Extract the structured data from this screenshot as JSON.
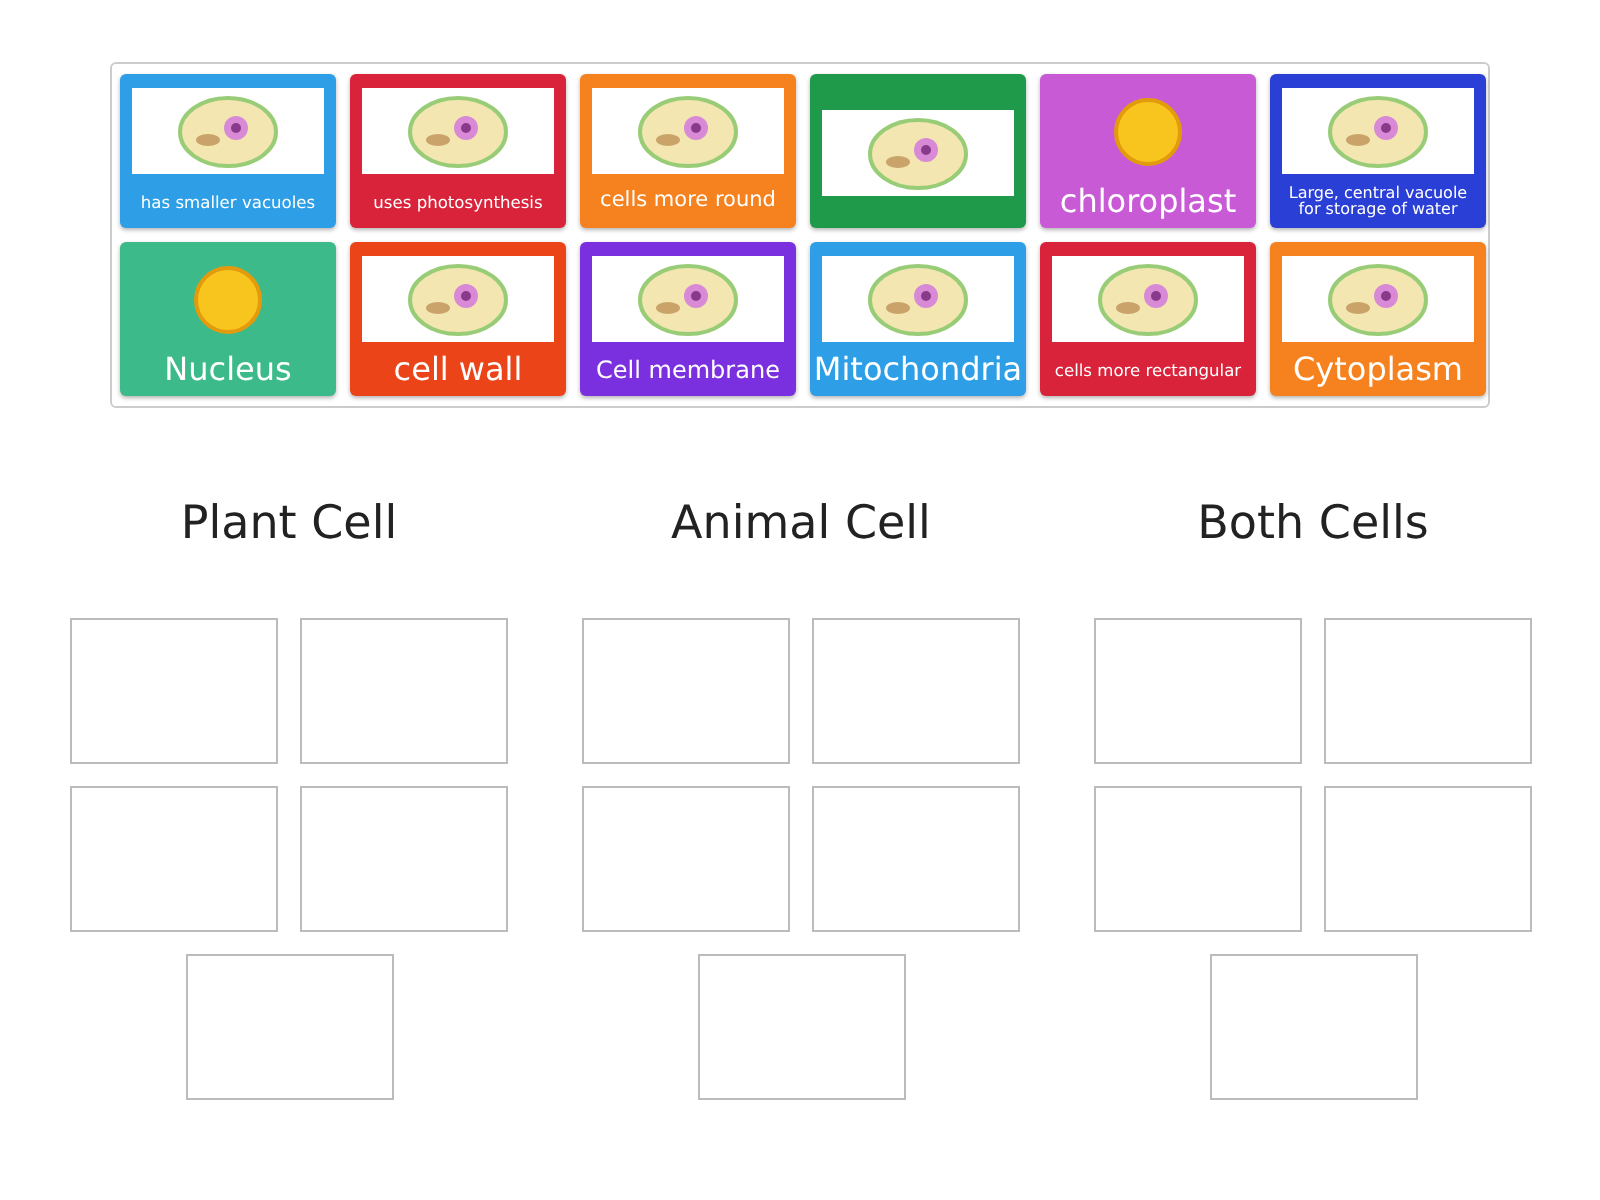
{
  "cards": [
    {
      "label": "has smaller vacuoles",
      "color": "#2e9fe6",
      "kind": "framed"
    },
    {
      "label": "uses photosynthesis",
      "color": "#d9233a",
      "kind": "framed"
    },
    {
      "label": "cells more round",
      "color": "#f5821f",
      "kind": "framed"
    },
    {
      "color": "#1f9a4b",
      "kind": "framed"
    },
    {
      "label": "chloroplast",
      "color": "#c85ad6",
      "kind": "bare"
    },
    {
      "label": "Large, central vacuole for storage of water",
      "color": "#2a3fd6",
      "kind": "framed"
    },
    {
      "label": "Nucleus",
      "color": "#3dba8a",
      "kind": "bare"
    },
    {
      "label": "cell wall",
      "color": "#ea4418",
      "kind": "framed"
    },
    {
      "label": "Cell membrane",
      "color": "#7b30e0",
      "kind": "framed"
    },
    {
      "label": "Mitochondria",
      "color": "#2e9fe6",
      "kind": "framed"
    },
    {
      "label": "cells more rectangular",
      "color": "#d9233a",
      "kind": "framed"
    },
    {
      "label": "Cytoplasm",
      "color": "#f5821f",
      "kind": "framed"
    }
  ],
  "groups": [
    {
      "title": "Plant Cell",
      "slots": [
        {
          "filled": false
        },
        {
          "filled": false
        },
        {
          "filled": false
        },
        {
          "filled": false
        },
        {
          "filled": false
        }
      ]
    },
    {
      "title": "Animal Cell",
      "slots": [
        {
          "filled": false
        },
        {
          "filled": false
        },
        {
          "filled": false
        },
        {
          "filled": false
        },
        {
          "filled": false
        }
      ]
    },
    {
      "title": "Both Cells",
      "slots": [
        {
          "filled": false
        },
        {
          "filled": false
        },
        {
          "filled": false
        },
        {
          "filled": false
        },
        {
          "filled": false
        }
      ]
    }
  ]
}
